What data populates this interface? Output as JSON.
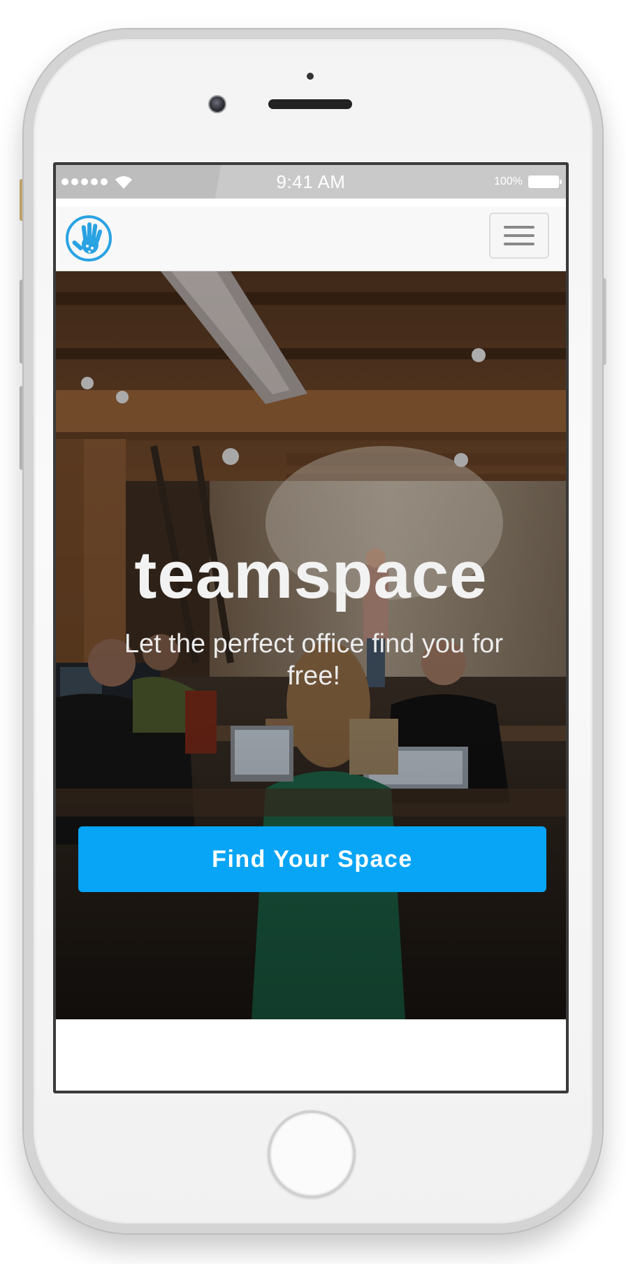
{
  "status_bar": {
    "time": "9:41 AM",
    "battery": "100%"
  },
  "navbar": {
    "logo_icon": "hand-logo-icon",
    "menu_icon": "hamburger-menu-icon"
  },
  "hero": {
    "title": "teamspace",
    "subtitle": "Let the perfect office find you for free!",
    "cta_label": "Find Your Space"
  },
  "colors": {
    "accent": "#08a4f5",
    "logo": "#2aa3e3",
    "navbar_bg": "#f8f8f8"
  }
}
